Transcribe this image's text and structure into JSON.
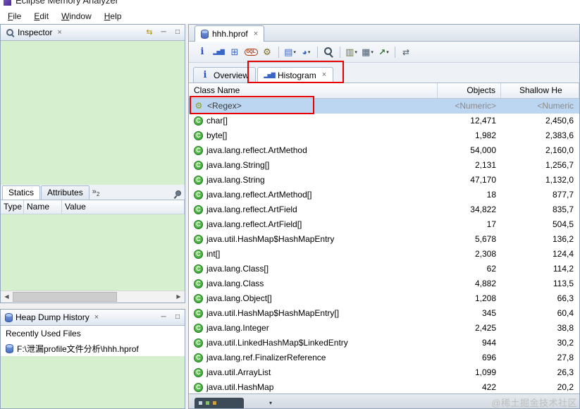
{
  "colors": {
    "annotation_red": "#e60000",
    "selection_blue": "#bcd6f2",
    "panel_green": "#d5efcf",
    "placeholder_gray": "#8a8a8a"
  },
  "window": {
    "title": "Eclipse Memory Analyzer",
    "menu": [
      {
        "name": "menu-file",
        "label": "File"
      },
      {
        "name": "menu-edit",
        "label": "Edit"
      },
      {
        "name": "menu-window",
        "label": "Window"
      },
      {
        "name": "menu-help",
        "label": "Help"
      }
    ]
  },
  "inspector": {
    "title": "Inspector",
    "close_glyph": "×",
    "minimize_glyph": "─",
    "maximize_glyph": "□",
    "sync_glyph": "⇆",
    "tabs": [
      {
        "name": "tab-statics",
        "label": "Statics"
      },
      {
        "name": "tab-attributes",
        "label": "Attributes"
      }
    ],
    "tab_overflow": {
      "chevrons": "»",
      "count": "2"
    },
    "columns": [
      "Type",
      "Name",
      "Value"
    ],
    "scrollbar": {
      "left_glyph": "◀",
      "right_glyph": "▶"
    }
  },
  "heap_dump_history": {
    "title": "Heap Dump History",
    "close_glyph": "×",
    "minimize_glyph": "─",
    "maximize_glyph": "□",
    "section_label": "Recently Used Files",
    "files": [
      "F:\\泄漏profile文件分析\\hhh.hprof"
    ]
  },
  "editor": {
    "tab_label": "hhh.hprof",
    "tab_close_glyph": "×",
    "toolbar_groups": [
      [
        {
          "name": "overview-info-icon",
          "caret": ""
        },
        {
          "name": "histogram-icon",
          "caret": ""
        },
        {
          "name": "dominator-tree-icon",
          "caret": ""
        },
        {
          "name": "oql-icon",
          "caret": ""
        },
        {
          "name": "leak-report-icon",
          "caret": ""
        }
      ],
      [
        {
          "name": "query-browser-icon",
          "caret": "▾"
        },
        {
          "name": "heap-objects-icon",
          "caret": "▾"
        }
      ],
      [
        {
          "name": "search-icon",
          "caret": ""
        }
      ],
      [
        {
          "name": "group-by-icon",
          "caret": "▾"
        },
        {
          "name": "table-columns-icon",
          "caret": "▾"
        },
        {
          "name": "export-icon",
          "caret": "▾"
        }
      ],
      [
        {
          "name": "compare-icon",
          "caret": ""
        }
      ]
    ],
    "inner_tabs": {
      "overview_label": "Overview",
      "histogram_label": "Histogram",
      "histogram_close_glyph": "×"
    }
  },
  "histogram": {
    "columns": {
      "class_name": "Class Name",
      "objects": "Objects",
      "shallow_heap": "Shallow He"
    },
    "filter_row": {
      "class_name": "<Regex>",
      "objects": "<Numeric>",
      "shallow_heap": "<Numeric"
    },
    "rows": [
      {
        "class_name": "char[]",
        "objects": "12,471",
        "shallow_heap": "2,450,6"
      },
      {
        "class_name": "byte[]",
        "objects": "1,982",
        "shallow_heap": "2,383,6"
      },
      {
        "class_name": "java.lang.reflect.ArtMethod",
        "objects": "54,000",
        "shallow_heap": "2,160,0"
      },
      {
        "class_name": "java.lang.String[]",
        "objects": "2,131",
        "shallow_heap": "1,256,7"
      },
      {
        "class_name": "java.lang.String",
        "objects": "47,170",
        "shallow_heap": "1,132,0"
      },
      {
        "class_name": "java.lang.reflect.ArtMethod[]",
        "objects": "18",
        "shallow_heap": "877,7"
      },
      {
        "class_name": "java.lang.reflect.ArtField",
        "objects": "34,822",
        "shallow_heap": "835,7"
      },
      {
        "class_name": "java.lang.reflect.ArtField[]",
        "objects": "17",
        "shallow_heap": "504,5"
      },
      {
        "class_name": "java.util.HashMap$HashMapEntry",
        "objects": "5,678",
        "shallow_heap": "136,2"
      },
      {
        "class_name": "int[]",
        "objects": "2,308",
        "shallow_heap": "124,4"
      },
      {
        "class_name": "java.lang.Class[]",
        "objects": "62",
        "shallow_heap": "114,2"
      },
      {
        "class_name": "java.lang.Class",
        "objects": "4,882",
        "shallow_heap": "113,5"
      },
      {
        "class_name": "java.lang.Object[]",
        "objects": "1,208",
        "shallow_heap": "66,3"
      },
      {
        "class_name": "java.util.HashMap$HashMapEntry[]",
        "objects": "345",
        "shallow_heap": "60,4"
      },
      {
        "class_name": "java.lang.Integer",
        "objects": "2,425",
        "shallow_heap": "38,8"
      },
      {
        "class_name": "java.util.LinkedHashMap$LinkedEntry",
        "objects": "944",
        "shallow_heap": "30,2"
      },
      {
        "class_name": "java.lang.ref.FinalizerReference",
        "objects": "696",
        "shallow_heap": "27,8"
      },
      {
        "class_name": "java.util.ArrayList",
        "objects": "1,099",
        "shallow_heap": "26,3"
      },
      {
        "class_name": "java.util.HashMap",
        "objects": "422",
        "shallow_heap": "20,2"
      }
    ]
  },
  "bottom_strip": {
    "caret": "▾"
  },
  "watermark": "@稀土掘金技术社区"
}
